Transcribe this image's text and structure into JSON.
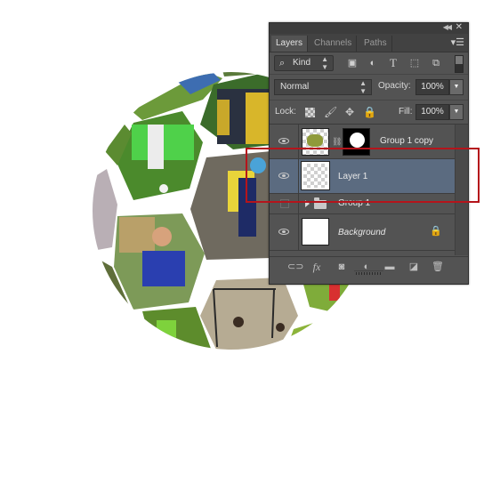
{
  "canvas": {
    "description": "Soccer ball shaped photo collage",
    "photo_tiles": [
      "soccer player kicking ball",
      "team celebrating in yellow kits",
      "youth players in green and white",
      "child in yellow raincoat on wet pitch",
      "boy in blue kit sitting on grass",
      "kids playing at goal on beach",
      "goalkeeper in green jersey",
      "player in red on green field"
    ]
  },
  "panel": {
    "collapse_icon": "collapse-arrows-icon",
    "close_icon": "close-icon",
    "tabs": [
      {
        "label": "Layers",
        "active": true
      },
      {
        "label": "Channels",
        "active": false
      },
      {
        "label": "Paths",
        "active": false
      }
    ],
    "menu_icon": "panel-menu-icon",
    "filter": {
      "kind_label": "Kind",
      "icons": [
        "pixel-filter-icon",
        "adjustment-filter-icon",
        "type-filter-icon",
        "shape-filter-icon",
        "smart-object-filter-icon"
      ]
    },
    "blend_mode": "Normal",
    "opacity_label": "Opacity:",
    "opacity_value": "100%",
    "lock_label": "Lock:",
    "lock_icons": [
      "lock-transparent-pixels-icon",
      "lock-image-pixels-icon",
      "lock-position-icon",
      "lock-all-icon"
    ],
    "fill_label": "Fill:",
    "fill_value": "100%",
    "layers": [
      {
        "name": "Group 1 copy",
        "visible": true,
        "selected": false,
        "has_mask": true
      },
      {
        "name": "Layer 1",
        "visible": true,
        "selected": true,
        "has_mask": false
      },
      {
        "name": "Group 1",
        "visible": false,
        "selected": false,
        "is_group": true,
        "collapsed": true
      },
      {
        "name": "Background",
        "visible": true,
        "selected": false,
        "locked": true
      }
    ],
    "bottom_icons": [
      "link-layers-icon",
      "fx-icon",
      "add-mask-icon",
      "adjustment-layer-icon",
      "new-group-icon",
      "new-layer-icon",
      "delete-icon"
    ],
    "colors": {
      "panel_bg": "#535353",
      "selected_row": "#5b6b80",
      "highlight_box": "#b5141b"
    }
  }
}
